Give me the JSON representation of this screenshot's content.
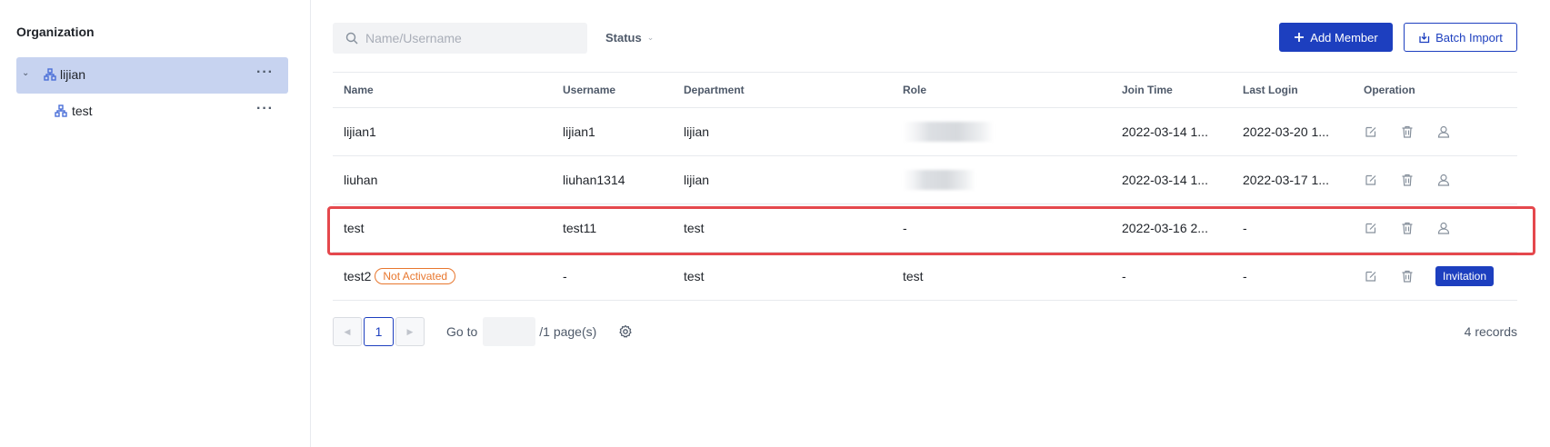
{
  "sidebar": {
    "title": "Organization",
    "nodes": [
      {
        "label": "lijian",
        "more": "···"
      },
      {
        "label": "test",
        "more": "···"
      }
    ]
  },
  "toolbar": {
    "search_placeholder": "Name/Username",
    "status_label": "Status",
    "add_member_label": "Add Member",
    "batch_import_label": "Batch Import"
  },
  "table": {
    "headers": [
      "Name",
      "Username",
      "Department",
      "Role",
      "Join Time",
      "Last Login",
      "Operation"
    ],
    "rows": [
      {
        "name": "lijian1",
        "badge": "",
        "username": "lijian1",
        "department": "lijian",
        "role": "",
        "join_time": "2022-03-14 1...",
        "last_login": "2022-03-20 1..."
      },
      {
        "name": "liuhan",
        "badge": "",
        "username": "liuhan1314",
        "department": "lijian",
        "role": "",
        "join_time": "2022-03-14 1...",
        "last_login": "2022-03-17 1..."
      },
      {
        "name": "test",
        "badge": "",
        "username": "test11",
        "department": "test",
        "role": "-",
        "join_time": "2022-03-16 2...",
        "last_login": "-"
      },
      {
        "name": "test2",
        "badge": "Not Activated",
        "username": "-",
        "department": "test",
        "role": "test",
        "join_time": "-",
        "last_login": "-",
        "action": "Invitation"
      }
    ]
  },
  "pagination": {
    "current_page": "1",
    "goto_label": "Go to",
    "pages_text": "/1 page(s)",
    "records_text": "4 records"
  },
  "colors": {
    "primary": "#1d3fbf",
    "selected_bg": "#c7d3f0",
    "badge_orange": "#e8772e",
    "highlight_red": "#e5484d"
  }
}
